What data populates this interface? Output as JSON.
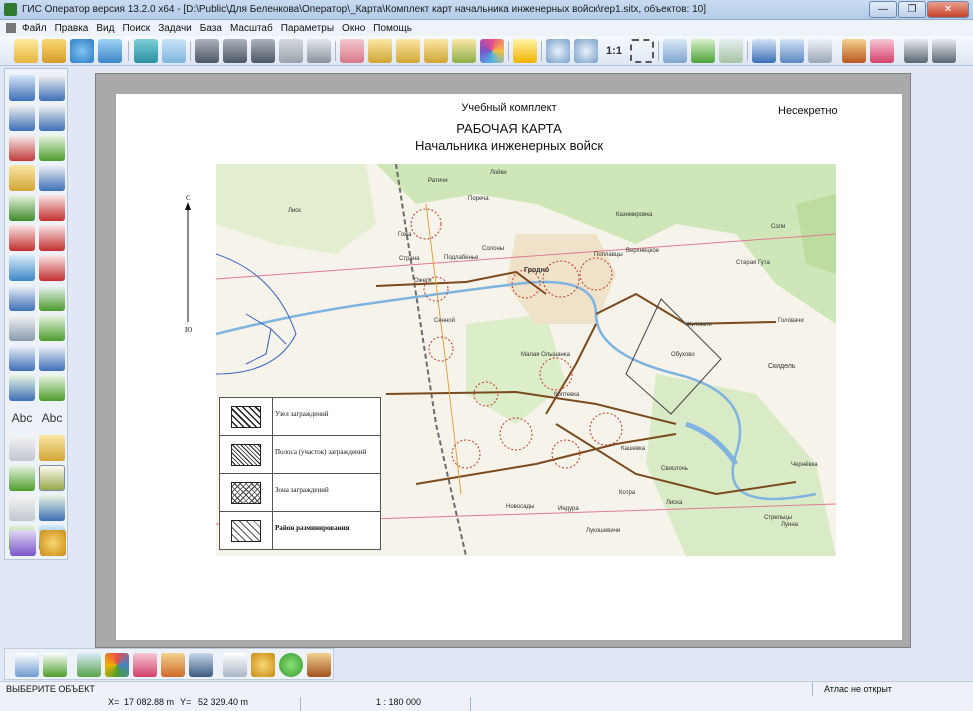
{
  "window": {
    "title": "ГИС Оператор версия 13.2.0 x64 - [D:\\Public\\Для Беленкова\\Оператор\\_Карта\\Комплект карт начальника инженерных войск\\rep1.sitx, объектов: 10]",
    "minimize": "—",
    "maximize": "❐",
    "close": "✕"
  },
  "menu": [
    "Файл",
    "Правка",
    "Вид",
    "Поиск",
    "Задачи",
    "База",
    "Масштаб",
    "Параметры",
    "Окно",
    "Помощь"
  ],
  "toolbar": {
    "zoom_one": "1:1"
  },
  "left_tools": {
    "text_tool_1": "Abc",
    "text_tool_2": "Abc"
  },
  "sheet": {
    "header_small": "Учебный комплект",
    "classification": "Несекретно",
    "title": "РАБОЧАЯ КАРТА",
    "subtitle": "Начальника инженерных войск"
  },
  "map": {
    "north_letter": "С",
    "south_letter": "Ю",
    "places": [
      "Лиск",
      "Лойки",
      "Ратичи",
      "Гродно",
      "Казимировка",
      "Поплавцы",
      "Верхнецкое",
      "Солоны",
      "Подлабенье",
      "Страна",
      "Ожеги",
      "Сенной",
      "Малая Ольшанка",
      "Коптевка",
      "Обухово",
      "Житомля",
      "Скидель",
      "Головачи",
      "Свислочь",
      "Кашевка",
      "Котра",
      "Индура",
      "Новосады",
      "Лукошевичи",
      "Соли",
      "Старая Гута",
      "Лиска",
      "Стрельцы",
      "Лунна",
      "Пореча",
      "Гожа",
      "Чернёвка"
    ],
    "legend": [
      {
        "label": "Узел заграждений",
        "pattern": "wide-hatch"
      },
      {
        "label": "Полоса (участок) заграждений",
        "pattern": "dense-hatch"
      },
      {
        "label": "Зона заграждений",
        "pattern": "cross-hatch"
      },
      {
        "label": "Район разминирования",
        "pattern": "light-hatch"
      }
    ]
  },
  "status": {
    "prompt": "ВЫБЕРИТЕ ОБЪЕКТ",
    "atlas": "Атлас не открыт",
    "x_label": "X=",
    "x_value": "17 082.88 m",
    "y_label": "Y=",
    "y_value": "52 329.40 m",
    "scale": "1 : 180 000"
  },
  "colors": {
    "accent": "#3d6fb6",
    "map_road": "#7a4a1e",
    "barrier": "#c0392b",
    "forest": "#cfe7b8"
  }
}
